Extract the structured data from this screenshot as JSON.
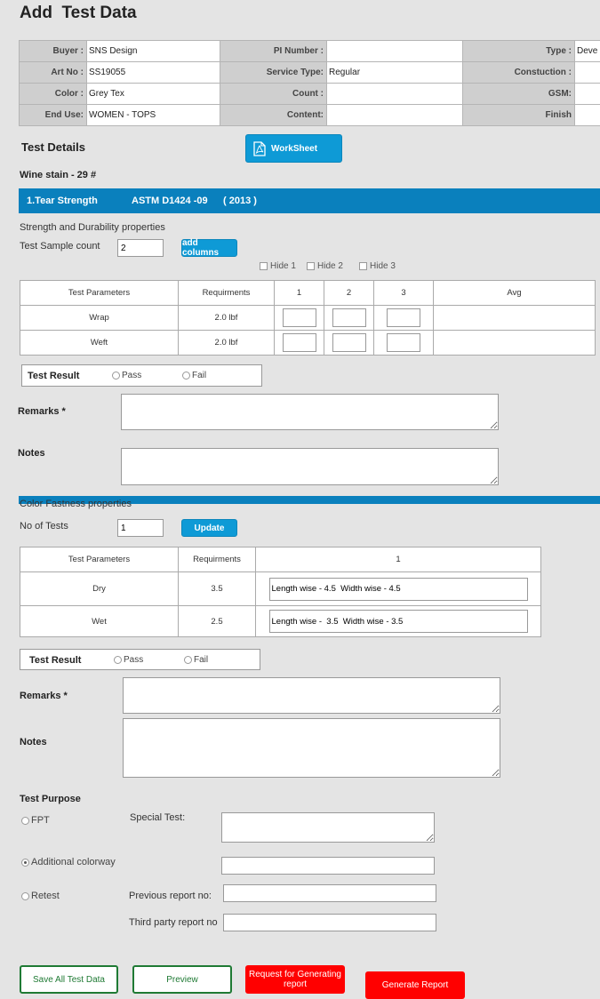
{
  "page": {
    "title": "Add  Test Data"
  },
  "info": {
    "rows": [
      {
        "l1": "Buyer :",
        "v1": "SNS Design",
        "l2": "PI Number :",
        "v2": "",
        "l3": "Type :",
        "v3": "Deve"
      },
      {
        "l1": "Art No :",
        "v1": "SS19055",
        "l2": "Service Type:",
        "v2": "Regular",
        "l3": "Constuction :",
        "v3": ""
      },
      {
        "l1": "Color :",
        "v1": "Grey Tex",
        "l2": "Count :",
        "v2": "",
        "l3": "GSM:",
        "v3": ""
      },
      {
        "l1": "End Use:",
        "v1": "WOMEN - TOPS",
        "l2": "Content:",
        "v2": "",
        "l3": "Finish",
        "v3": ""
      }
    ]
  },
  "test_details": {
    "heading": "Test Details",
    "worksheet_label": "WorkSheet",
    "sample_name": "Wine stain - 29 #"
  },
  "tear": {
    "bar_title": "1.Tear Strength",
    "bar_method": "ASTM D1424 -09",
    "bar_year": "( 2013 )",
    "category": "Strength and Durability  properties",
    "sample_count_label": "Test Sample count",
    "sample_count_value": "2",
    "add_columns_label": "add columns",
    "hide": [
      "Hide 1",
      "Hide 2",
      "Hide 3"
    ],
    "headers": [
      "Test Parameters",
      "Requirments",
      "1",
      "2",
      "3",
      "Avg"
    ],
    "rows": [
      {
        "param": "Wrap",
        "req": "2.0 lbf"
      },
      {
        "param": "Weft",
        "req": "2.0 lbf"
      }
    ],
    "result_label": "Test Result",
    "pass": "Pass",
    "fail": "Fail",
    "remarks_label": "Remarks *",
    "notes_label": "Notes"
  },
  "color": {
    "category": "Color Fastness properties",
    "tests_label": "No of Tests",
    "tests_value": "1",
    "update_label": "Update",
    "headers": [
      "Test Parameters",
      "Requirments",
      "1"
    ],
    "rows": [
      {
        "param": "Dry",
        "req": "3.5",
        "value": "Length wise - 4.5  Width wise - 4.5"
      },
      {
        "param": "Wet",
        "req": "2.5",
        "value": "Length wise -  3.5  Width wise - 3.5"
      }
    ],
    "result_label": "Test Result",
    "pass": "Pass",
    "fail": "Fail",
    "remarks_label": "Remarks *",
    "notes_label": "Notes"
  },
  "purpose": {
    "heading": "Test Purpose",
    "fpt": "FPT",
    "special_test": "Special Test:",
    "additional": "Additional colorway",
    "retest": "Retest",
    "previous_report": "Previous report no:",
    "third_party": "Third party report no"
  },
  "actions": {
    "save": "Save All Test Data",
    "preview": "Preview",
    "request": "Request for Generating report",
    "generate": "Generate Report"
  },
  "colors": {
    "accent_bar": "#0a80bd",
    "blue_button": "#0e9ad6",
    "green": "#1f7a34",
    "red": "#ff0000"
  }
}
